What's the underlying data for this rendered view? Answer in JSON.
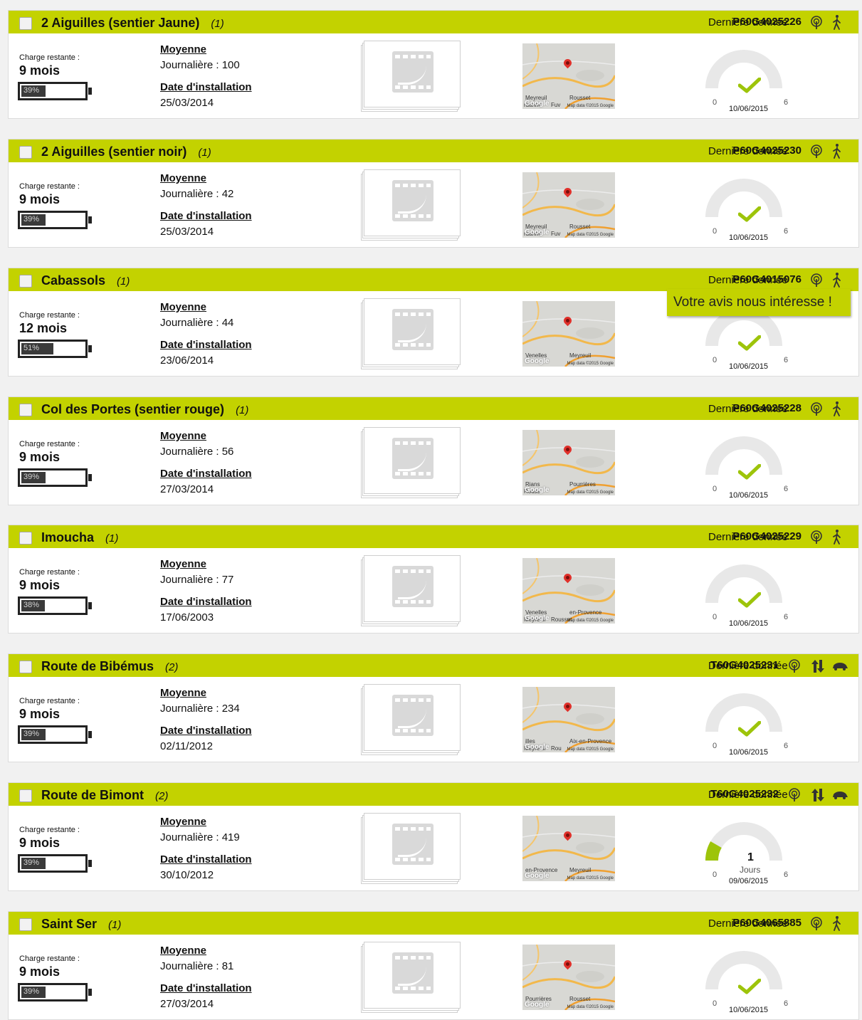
{
  "labels": {
    "charge_remaining": "Charge restante :",
    "average": "Moyenne",
    "installation_date": "Date d'installation",
    "last_data": "Dernière donnée",
    "gauge_min": "0",
    "gauge_max": "6"
  },
  "feedback_banner": "Votre avis nous intéresse !",
  "map_attribution": "Map data ©2015 Google",
  "map_logo": "Google",
  "colors": {
    "accent": "#c3d200",
    "check": "#9dc40a",
    "gauge_track": "#e8e8e8",
    "gauge_fill": "#9dc40a"
  },
  "counters": [
    {
      "name": "2 Aiguilles (sentier Jaune)",
      "count": "(1)",
      "serial": "P60G4025226",
      "type_icons": [
        "sensor-icon",
        "pedestrian-icon"
      ],
      "charge": "9 mois",
      "battery_pct": "39%",
      "battery_level": 0.39,
      "daily": "Journalière : 100",
      "install_date": "25/03/2014",
      "status": "ok",
      "gauge_date": "10/06/2015",
      "map_places": [
        "Meyreuil",
        "Rousset",
        "rdanne",
        "Fuv"
      ]
    },
    {
      "name": "2 Aiguilles (sentier noir)",
      "count": "(1)",
      "serial": "P60G4025230",
      "type_icons": [
        "sensor-icon",
        "pedestrian-icon"
      ],
      "charge": "9 mois",
      "battery_pct": "39%",
      "battery_level": 0.39,
      "daily": "Journalière : 42",
      "install_date": "25/03/2014",
      "status": "ok",
      "gauge_date": "10/06/2015",
      "map_places": [
        "Meyreuil",
        "Rousset",
        "rdanne",
        "Fuv"
      ]
    },
    {
      "name": "Cabassols",
      "count": "(1)",
      "serial": "P60G4015076",
      "type_icons": [
        "sensor-icon",
        "pedestrian-icon"
      ],
      "charge": "12 mois",
      "battery_pct": "51%",
      "battery_level": 0.51,
      "daily": "Journalière : 44",
      "install_date": "23/06/2014",
      "status": "ok",
      "gauge_date": "10/06/2015",
      "map_places": [
        "Venelles",
        "Meyreuil"
      ]
    },
    {
      "name": "Col des Portes (sentier rouge)",
      "count": "(1)",
      "serial": "P60G4025228",
      "type_icons": [
        "sensor-icon",
        "pedestrian-icon"
      ],
      "charge": "9 mois",
      "battery_pct": "39%",
      "battery_level": 0.39,
      "daily": "Journalière : 56",
      "install_date": "27/03/2014",
      "status": "ok",
      "gauge_date": "10/06/2015",
      "map_places": [
        "Rians",
        "Pourrières",
        "Rouss"
      ]
    },
    {
      "name": "Imoucha",
      "count": "(1)",
      "serial": "P60G4025229",
      "type_icons": [
        "sensor-icon",
        "pedestrian-icon"
      ],
      "charge": "9 mois",
      "battery_pct": "38%",
      "battery_level": 0.38,
      "daily": "Journalière : 77",
      "install_date": "17/06/2003",
      "status": "ok",
      "gauge_date": "10/06/2015",
      "map_places": [
        "Venelles",
        "en-Provence",
        "Meyreuil",
        "Rousset"
      ]
    },
    {
      "name": "Route de Bibémus",
      "count": "(2)",
      "serial": "T60G4025231",
      "type_icons": [
        "sensor-icon",
        "bidirectional-arrows-icon",
        "car-icon"
      ],
      "charge": "9 mois",
      "battery_pct": "39%",
      "battery_level": 0.39,
      "daily": "Journalière : 234",
      "install_date": "02/11/2012",
      "status": "ok",
      "gauge_date": "10/06/2015",
      "map_places": [
        "illes",
        "Aix-en-Provence",
        "Meyreuil",
        "Rou"
      ]
    },
    {
      "name": "Route de Bimont",
      "count": "(2)",
      "serial": "T60G4025232",
      "type_icons": [
        "sensor-icon",
        "bidirectional-arrows-icon",
        "car-icon"
      ],
      "charge": "9 mois",
      "battery_pct": "39%",
      "battery_level": 0.39,
      "daily": "Journalière : 419",
      "install_date": "30/10/2012",
      "status": "days",
      "gauge_value": "1",
      "gauge_unit": "Jours",
      "gauge_level": 0.1667,
      "gauge_date": "09/06/2015",
      "map_places": [
        "en-Provence",
        "Meyreuil"
      ]
    },
    {
      "name": "Saint Ser",
      "count": "(1)",
      "serial": "P60G4065885",
      "type_icons": [
        "sensor-icon",
        "pedestrian-icon"
      ],
      "charge": "9 mois",
      "battery_pct": "39%",
      "battery_level": 0.39,
      "daily": "Journalière : 81",
      "install_date": "27/03/2014",
      "status": "ok",
      "gauge_date": "10/06/2015",
      "map_places": [
        "Pourrières",
        "Rousset"
      ]
    }
  ]
}
